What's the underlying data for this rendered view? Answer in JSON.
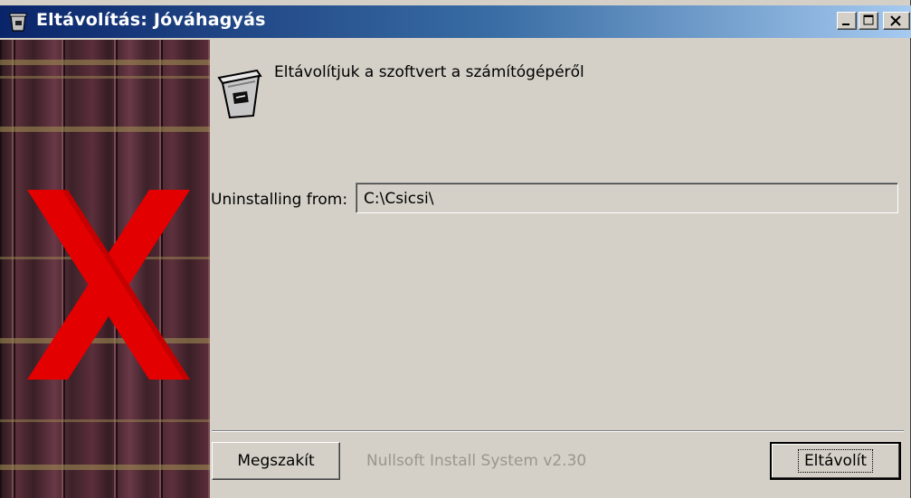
{
  "window": {
    "title": "Eltávolítás: Jóváhagyás",
    "controls": [
      "minimize",
      "maximize",
      "close"
    ]
  },
  "header": {
    "text": "Eltávolítjuk a szoftvert a számítógépéről",
    "icon": "trash-icon"
  },
  "sidebar": {
    "image": "book-spines-image",
    "overlay": "red-x-icon"
  },
  "uninstall_from": {
    "label": "Uninstalling from:",
    "value": "C:\\Csicsi\\"
  },
  "buttons": {
    "cancel": "Megszakít",
    "uninstall": "Eltávolít"
  },
  "branding": "Nullsoft Install System v2.30",
  "colors": {
    "titlebar_start": "#0a246a",
    "titlebar_end": "#a6caf0",
    "face": "#d4d0c8",
    "x_red": "#e30000"
  }
}
